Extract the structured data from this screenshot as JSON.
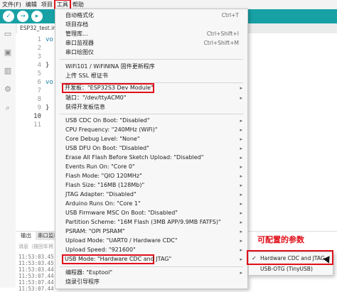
{
  "menubar": {
    "items": [
      "文件(F)",
      "编辑",
      "项目",
      "工具",
      "帮助"
    ]
  },
  "editor": {
    "tab_label": "ESP32_test.inc",
    "line_numbers": [
      "1",
      "2",
      "3",
      "4",
      "5",
      "6",
      "7",
      "8",
      "9",
      "10",
      "11"
    ],
    "current_line": "10",
    "code": {
      "l1": "vo",
      "l4": "}",
      "l6": "vo",
      "l9": "}"
    }
  },
  "bottom_panel": {
    "tabs": [
      "输出",
      "串口监视"
    ],
    "hint": "消息（按回车将",
    "log_lines": [
      "11:53:03.45",
      "11:53:03.45",
      "11:53:03.44",
      "11:53:07.44",
      "11:53:07.44",
      "11:53:07.44"
    ]
  },
  "tools_menu": {
    "items": [
      {
        "label": "自动格式化",
        "shortcut": "Ctrl+T"
      },
      {
        "label": "项目存档",
        "shortcut": ""
      },
      {
        "label": "管理库...",
        "shortcut": "Ctrl+Shift+I"
      },
      {
        "label": "串口监视器",
        "shortcut": "Ctrl+Shift+M"
      },
      {
        "label": "串口绘图仪",
        "shortcut": ""
      },
      {
        "label": "WiFi101 / WiFiNINA 固件更新程序",
        "shortcut": ""
      },
      {
        "label": "上传 SSL 根证书",
        "shortcut": ""
      },
      {
        "label": "开发板：\"ESP32S3 Dev Module\"",
        "shortcut": ""
      },
      {
        "label": "端口：\"/dev/ttyACM0\"",
        "shortcut": ""
      },
      {
        "label": "获得开发板信息",
        "shortcut": ""
      },
      {
        "label": "USB CDC On Boot: \"Disabled\"",
        "shortcut": ""
      },
      {
        "label": "CPU Frequency: \"240MHz (WiFi)\"",
        "shortcut": ""
      },
      {
        "label": "Core Debug Level: \"None\"",
        "shortcut": ""
      },
      {
        "label": "USB DFU On Boot: \"Disabled\"",
        "shortcut": ""
      },
      {
        "label": "Erase All Flash Before Sketch Upload: \"Disabled\"",
        "shortcut": ""
      },
      {
        "label": "Events Run On: \"Core 0\"",
        "shortcut": ""
      },
      {
        "label": "Flash Mode: \"QIO 120MHz\"",
        "shortcut": ""
      },
      {
        "label": "Flash Size: \"16MB (128Mb)\"",
        "shortcut": ""
      },
      {
        "label": "JTAG Adapter: \"Disabled\"",
        "shortcut": ""
      },
      {
        "label": "Arduino Runs On: \"Core 1\"",
        "shortcut": ""
      },
      {
        "label": "USB Firmware MSC On Boot: \"Disabled\"",
        "shortcut": ""
      },
      {
        "label": "Partition Scheme: \"16M Flash (3MB APP/9.9MB FATFS)\"",
        "shortcut": ""
      },
      {
        "label": "PSRAM: \"OPI PSRAM\"",
        "shortcut": ""
      },
      {
        "label": "Upload Mode: \"UART0 / Hardware CDC\"",
        "shortcut": ""
      },
      {
        "label": "Upload Speed: \"921600\"",
        "shortcut": ""
      },
      {
        "label": "USB Mode: \"Hardware CDC and JTAG\"",
        "shortcut": ""
      },
      {
        "label": "编程器: \"Esptool\"",
        "shortcut": ""
      },
      {
        "label": "烧录引导程序",
        "shortcut": ""
      }
    ]
  },
  "usb_mode_submenu": {
    "items": [
      {
        "label": "Hardware CDC and JTAG",
        "checked": "✓"
      },
      {
        "label": "USB-OTG (TinyUSB)",
        "checked": ""
      }
    ]
  },
  "annotation": "可配置的参数",
  "colors": {
    "accent": "#17a1a5",
    "highlight": "#e0101a"
  }
}
